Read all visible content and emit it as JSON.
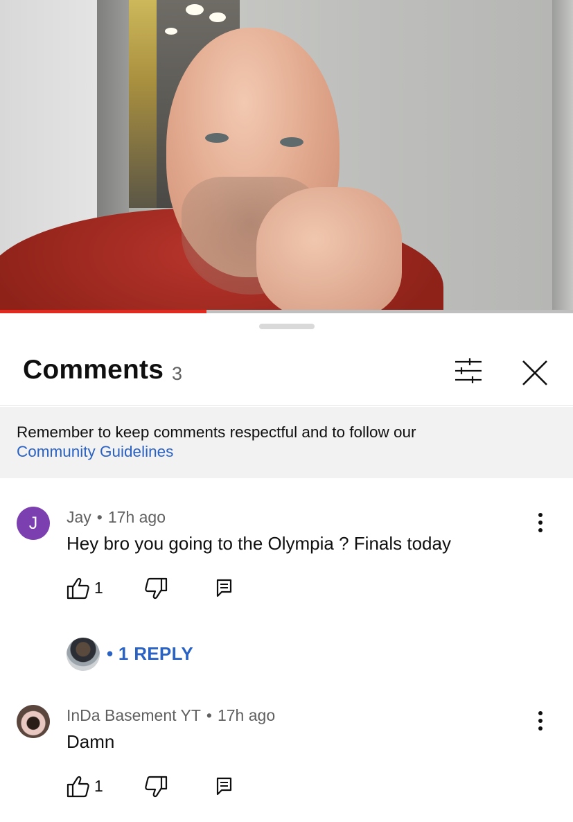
{
  "video": {
    "progress_fraction": 0.36
  },
  "comments_panel": {
    "title": "Comments",
    "count": "3",
    "notice_text": "Remember to keep comments respectful and to follow our",
    "notice_link": "Community Guidelines",
    "comments": [
      {
        "avatar_letter": "J",
        "author": "Jay",
        "separator": "•",
        "time": "17h ago",
        "text": "Hey bro you going to the Olympia ? Finals today",
        "likes": "1",
        "replies_label": "• 1 REPLY"
      },
      {
        "author": "InDa Basement YT",
        "separator": "•",
        "time": "17h ago",
        "text": "Damn",
        "likes": "1"
      }
    ]
  },
  "colors": {
    "accent_link": "#2a62c4",
    "progress_played": "#e02a20",
    "avatar_jay": "#7b3fb0"
  },
  "icons": {
    "filter": "sliders-icon",
    "close": "close-icon",
    "more": "more-vertical-icon",
    "like": "thumbs-up-icon",
    "dislike": "thumbs-down-icon",
    "reply": "comment-icon"
  }
}
